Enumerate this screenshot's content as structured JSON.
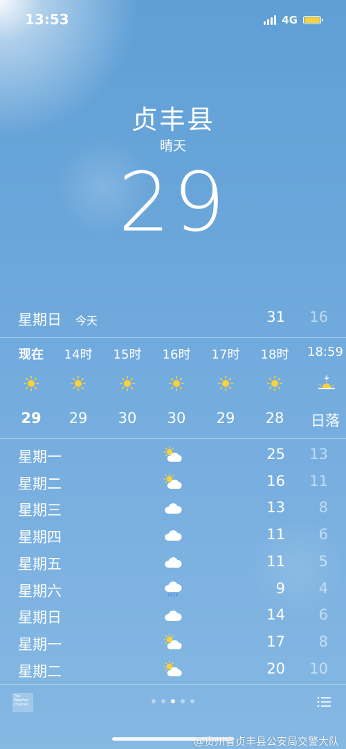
{
  "status_bar": {
    "time": "13:53",
    "network": "4G",
    "battery_icon": "battery-icon",
    "battery_color": "#f5d33a"
  },
  "header": {
    "city": "贞丰县",
    "condition": "晴天",
    "temperature": "29"
  },
  "today": {
    "day": "星期日",
    "tag": "今天",
    "high": "31",
    "low": "16"
  },
  "hourly": [
    {
      "time": "现在",
      "icon": "sun-icon",
      "temp": "29"
    },
    {
      "time": "14时",
      "icon": "sun-icon",
      "temp": "29"
    },
    {
      "time": "15时",
      "icon": "sun-icon",
      "temp": "30"
    },
    {
      "time": "16时",
      "icon": "sun-icon",
      "temp": "30"
    },
    {
      "time": "17时",
      "icon": "sun-icon",
      "temp": "29"
    },
    {
      "time": "18时",
      "icon": "sun-icon",
      "temp": "28"
    },
    {
      "time": "18:59",
      "icon": "sunset-icon",
      "temp": "日落"
    }
  ],
  "daily": [
    {
      "day": "星期一",
      "icon": "partly-sunny-icon",
      "high": "25",
      "low": "13"
    },
    {
      "day": "星期二",
      "icon": "partly-sunny-icon",
      "high": "16",
      "low": "11"
    },
    {
      "day": "星期三",
      "icon": "cloud-icon",
      "high": "13",
      "low": "8"
    },
    {
      "day": "星期四",
      "icon": "cloud-icon",
      "high": "11",
      "low": "6"
    },
    {
      "day": "星期五",
      "icon": "cloud-icon",
      "high": "11",
      "low": "5"
    },
    {
      "day": "星期六",
      "icon": "rain-cloud-icon",
      "high": "9",
      "low": "4"
    },
    {
      "day": "星期日",
      "icon": "cloud-icon",
      "high": "14",
      "low": "6"
    },
    {
      "day": "星期一",
      "icon": "partly-sunny-icon",
      "high": "17",
      "low": "8"
    },
    {
      "day": "星期二",
      "icon": "partly-sunny-icon",
      "high": "20",
      "low": "10"
    }
  ],
  "footer": {
    "logo_text": "The Weather Channel",
    "page_count": 5,
    "active_page": 3
  },
  "watermark": "@贵州省贞丰县公安局交警大队"
}
